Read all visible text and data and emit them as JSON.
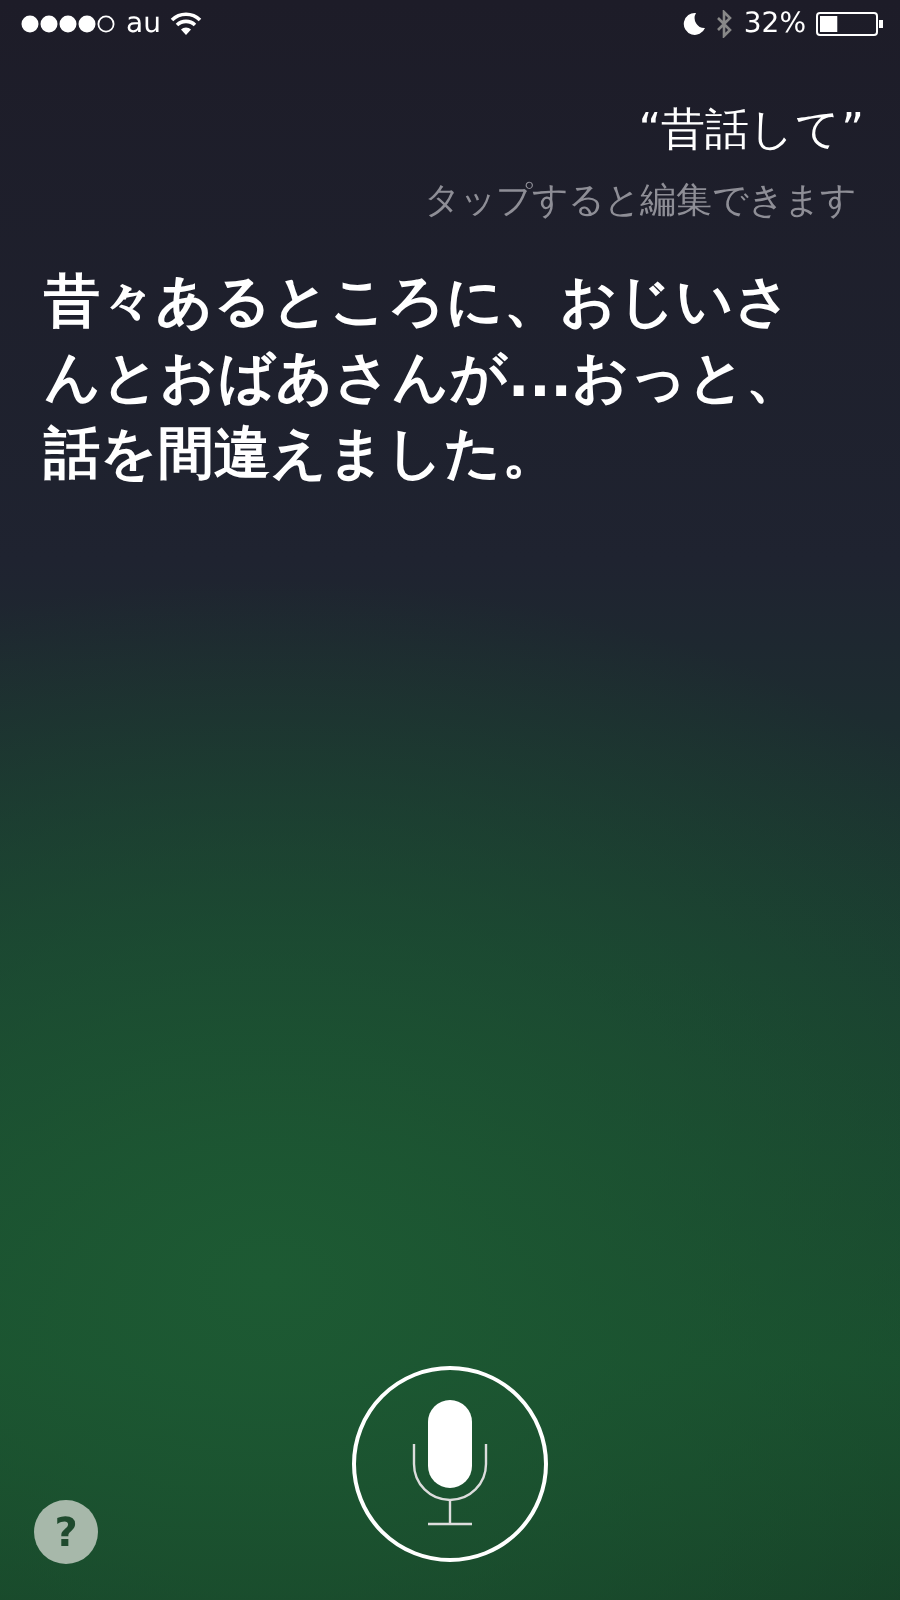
{
  "status_bar": {
    "carrier": "au",
    "battery_percent": "32%",
    "battery": {
      "level": 0.32
    }
  },
  "query": {
    "text": "“昔話して”",
    "hint": "タップすると編集できます"
  },
  "response": {
    "text": "昔々あるところに、おじいさんとおばあさんが...おっと、話を間違えました。"
  },
  "help_button": {
    "label": "?"
  }
}
